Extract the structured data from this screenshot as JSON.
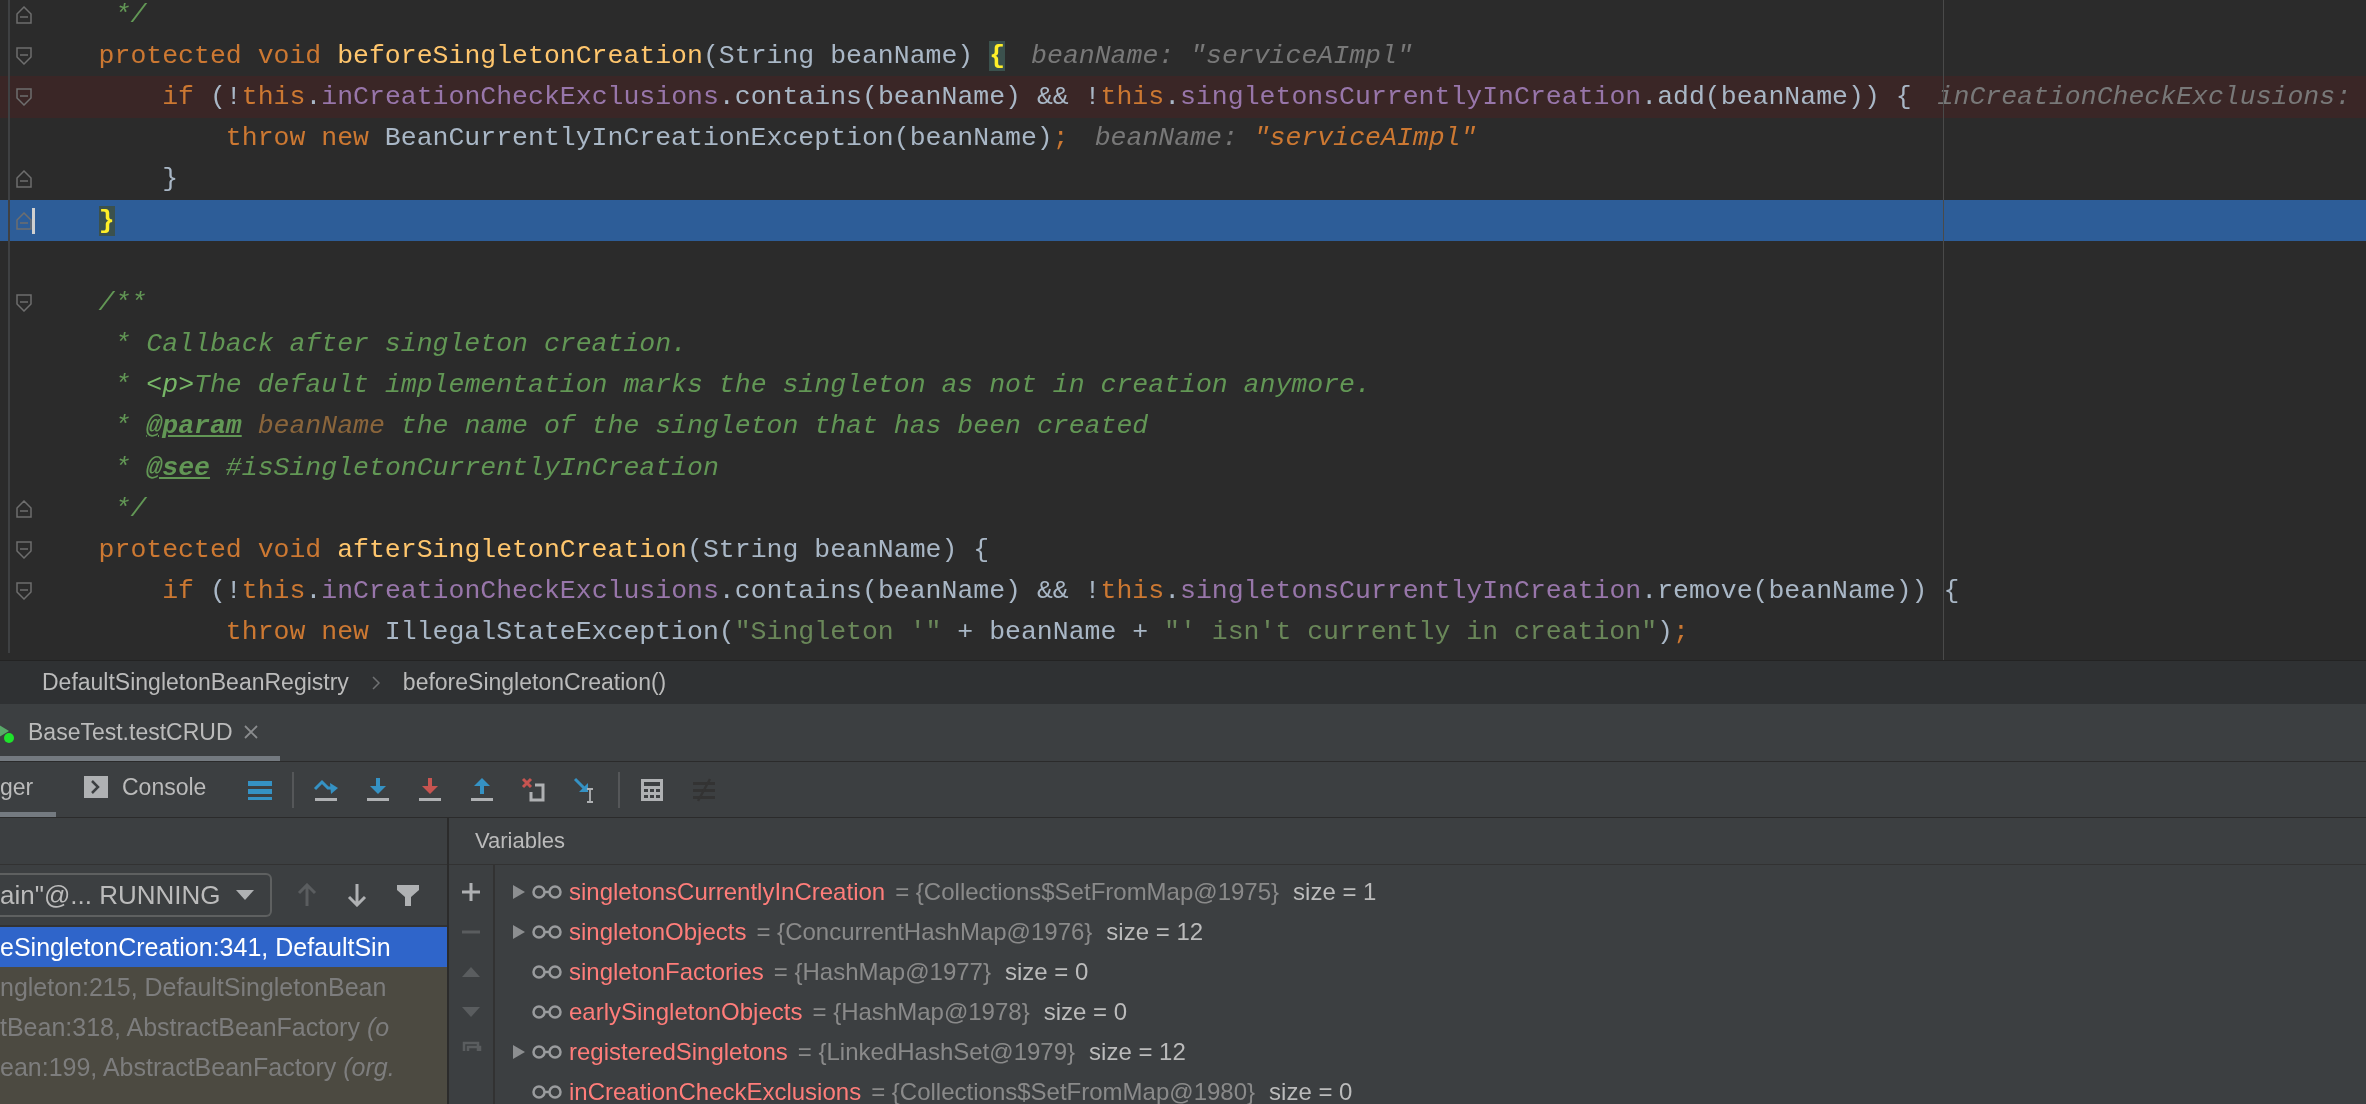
{
  "editor": {
    "lines": [
      {
        "kind": "normal",
        "fold_start": false,
        "fold_end": true,
        "tokens": [
          {
            "t": "     */",
            "kind": "comment"
          }
        ]
      },
      {
        "kind": "normal",
        "fold_start": true,
        "fold_end": false,
        "tokens": [
          {
            "t": "    protected void ",
            "kind": "keyword"
          },
          {
            "t": "beforeSingletonCreation",
            "kind": "declaration"
          },
          {
            "t": "(String beanName) ",
            "kind": "plain"
          },
          {
            "t": "{",
            "kind": "brace"
          }
        ],
        "hints": [
          {
            "label": "beanName: ",
            "value": "\"serviceAImpl\"",
            "changed": false
          }
        ]
      },
      {
        "kind": "flagged",
        "fold_start": true,
        "fold_end": false,
        "tokens": [
          {
            "t": "        if ",
            "kind": "keyword"
          },
          {
            "t": "(!",
            "kind": "plain"
          },
          {
            "t": "this",
            "kind": "keyword"
          },
          {
            "t": ".",
            "kind": "plain"
          },
          {
            "t": "inCreationCheckExclusions",
            "kind": "field"
          },
          {
            "t": ".contains(beanName) && !",
            "kind": "plain"
          },
          {
            "t": "this",
            "kind": "keyword"
          },
          {
            "t": ".",
            "kind": "plain"
          },
          {
            "t": "singletonsCurrentlyInCreation",
            "kind": "field"
          },
          {
            "t": ".add(beanName)) {",
            "kind": "plain"
          }
        ],
        "hints": [
          {
            "label": "inCreationCheckExclusions:"
          }
        ]
      },
      {
        "kind": "normal",
        "fold_start": false,
        "fold_end": false,
        "tokens": [
          {
            "t": "            throw new ",
            "kind": "keyword"
          },
          {
            "t": "BeanCurrentlyInCreationException(beanName)",
            "kind": "plain"
          },
          {
            "t": ";",
            "kind": "keyword"
          }
        ],
        "hints": [
          {
            "label": "beanName: ",
            "value": "\"serviceAImpl\"",
            "changed": true
          }
        ]
      },
      {
        "kind": "normal",
        "fold_start": false,
        "fold_end": true,
        "tokens": [
          {
            "t": "        }",
            "kind": "plain"
          }
        ]
      },
      {
        "kind": "current",
        "fold_start": false,
        "fold_end": true,
        "tokens": [
          {
            "t": "    }",
            "kind": "brace"
          }
        ]
      },
      {
        "kind": "normal"
      },
      {
        "kind": "normal",
        "fold_start": true,
        "fold_end": false,
        "tokens": [
          {
            "t": "    /**",
            "kind": "comment"
          }
        ]
      },
      {
        "kind": "normal",
        "fold_start": false,
        "fold_end": false,
        "tokens": [
          {
            "t": "     * Callback after singleton creation.",
            "kind": "comment"
          }
        ]
      },
      {
        "kind": "normal",
        "fold_start": false,
        "fold_end": false,
        "tokens": [
          {
            "t": "     * ",
            "kind": "comment"
          },
          {
            "t": "<p>",
            "kind": "tag"
          },
          {
            "t": "The default implementation marks the singleton as not in creation anymore.",
            "kind": "comment"
          }
        ]
      },
      {
        "kind": "normal",
        "fold_start": false,
        "fold_end": false,
        "tokens": [
          {
            "t": "     * ",
            "kind": "comment"
          },
          {
            "t": "@param",
            "kind": "doctag"
          },
          {
            "t": " beanName",
            "kind": "docparam"
          },
          {
            "t": " the name of the singleton that has been created",
            "kind": "comment"
          }
        ]
      },
      {
        "kind": "normal",
        "fold_start": false,
        "fold_end": false,
        "tokens": [
          {
            "t": "     * ",
            "kind": "comment"
          },
          {
            "t": "@see",
            "kind": "doctag"
          },
          {
            "t": " #isSingletonCurrentlyInCreation",
            "kind": "comment"
          }
        ]
      },
      {
        "kind": "normal",
        "fold_start": false,
        "fold_end": true,
        "tokens": [
          {
            "t": "     */",
            "kind": "comment"
          }
        ]
      },
      {
        "kind": "normal",
        "fold_start": true,
        "fold_end": false,
        "tokens": [
          {
            "t": "    protected void ",
            "kind": "keyword"
          },
          {
            "t": "afterSingletonCreation",
            "kind": "declaration"
          },
          {
            "t": "(String beanName) {",
            "kind": "plain"
          }
        ]
      },
      {
        "kind": "normal",
        "fold_start": true,
        "fold_end": false,
        "tokens": [
          {
            "t": "        if ",
            "kind": "keyword"
          },
          {
            "t": "(!",
            "kind": "plain"
          },
          {
            "t": "this",
            "kind": "keyword"
          },
          {
            "t": ".",
            "kind": "plain"
          },
          {
            "t": "inCreationCheckExclusions",
            "kind": "field"
          },
          {
            "t": ".contains(beanName) && !",
            "kind": "plain"
          },
          {
            "t": "this",
            "kind": "keyword"
          },
          {
            "t": ".",
            "kind": "plain"
          },
          {
            "t": "singletonsCurrentlyInCreation",
            "kind": "field"
          },
          {
            "t": ".remove(beanName)) {",
            "kind": "plain"
          }
        ]
      },
      {
        "kind": "normal",
        "fold_start": false,
        "fold_end": false,
        "tokens": [
          {
            "t": "            throw new ",
            "kind": "keyword"
          },
          {
            "t": "IllegalStateException(",
            "kind": "plain"
          },
          {
            "t": "\"Singleton '\"",
            "kind": "string"
          },
          {
            "t": " + beanName + ",
            "kind": "plain"
          },
          {
            "t": "\"' isn't currently in creation\"",
            "kind": "string"
          },
          {
            "t": ")",
            "kind": "plain"
          },
          {
            "t": ";",
            "kind": "keyword"
          }
        ]
      }
    ]
  },
  "breadcrumbs": [
    "DefaultSingletonBeanRegistry",
    "beforeSingletonCreation()"
  ],
  "run_tab": {
    "label": "BaseTest.testCRUD"
  },
  "debug_tabs": [
    {
      "label": "ger",
      "selected": true
    },
    {
      "label": "Console",
      "selected": false
    }
  ],
  "toolbar": [
    {
      "kind": "frames",
      "disabled": false,
      "separator_before": false
    },
    {
      "kind": "step-over",
      "disabled": false,
      "separator_before": true
    },
    {
      "kind": "step-into",
      "disabled": false,
      "separator_before": false
    },
    {
      "kind": "force-step-into",
      "disabled": false,
      "separator_before": false
    },
    {
      "kind": "step-out",
      "disabled": false,
      "separator_before": false
    },
    {
      "kind": "drop-frame",
      "disabled": false,
      "separator_before": false
    },
    {
      "kind": "run-to-cursor",
      "disabled": false,
      "separator_before": false
    },
    {
      "kind": "evaluate",
      "disabled": false,
      "separator_before": true
    },
    {
      "kind": "trace",
      "disabled": true,
      "separator_before": false
    }
  ],
  "frames": {
    "thread": "ain\"@... RUNNING",
    "up_disabled": true,
    "items": [
      {
        "text": "eSingletonCreation:341, DefaultSin",
        "selected": true
      },
      {
        "text": "ngleton:215, DefaultSingletonBean",
        "selected": false
      },
      {
        "text": "tBean:318, AbstractBeanFactory *(o*",
        "selected": false
      },
      {
        "text": "ean:199, AbstractBeanFactory *(org.*",
        "selected": false
      }
    ]
  },
  "variables": {
    "title": "Variables",
    "items": [
      {
        "name": "singletonsCurrentlyInCreation",
        "value": "= {Collections$SetFromMap@1975}",
        "size": "size = 1",
        "expandable": true
      },
      {
        "name": "singletonObjects",
        "value": "= {ConcurrentHashMap@1976}",
        "size": "size = 12",
        "expandable": true
      },
      {
        "name": "singletonFactories",
        "value": "= {HashMap@1977}",
        "size": "size = 0",
        "expandable": false
      },
      {
        "name": "earlySingletonObjects",
        "value": "= {HashMap@1978}",
        "size": "size = 0",
        "expandable": false
      },
      {
        "name": "registeredSingletons",
        "value": "= {LinkedHashSet@1979}",
        "size": "size = 12",
        "expandable": true
      },
      {
        "name": "inCreationCheckExclusions",
        "value": "= {Collections$SetFromMap@1980}",
        "size": "size = 0",
        "expandable": false
      }
    ]
  }
}
